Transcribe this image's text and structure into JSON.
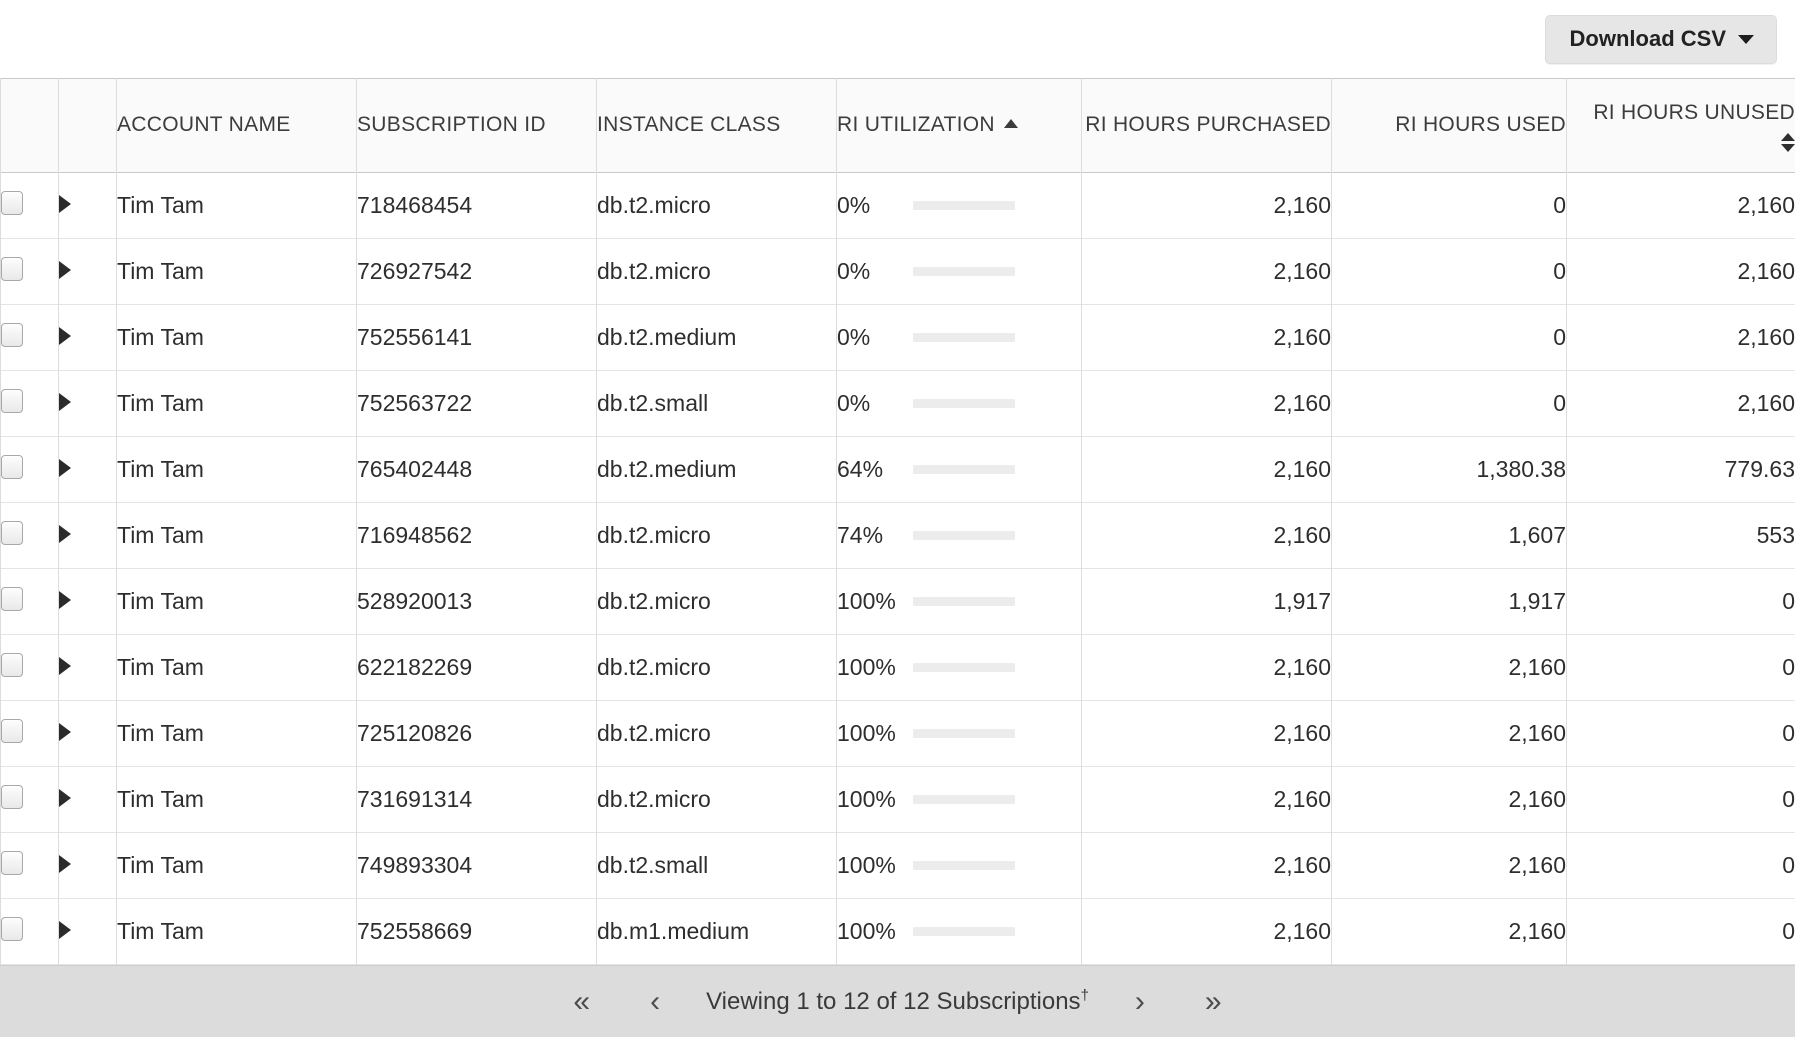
{
  "toolbar": {
    "download_label": "Download CSV",
    "caret_icon": "caret-down-icon"
  },
  "table": {
    "columns": [
      {
        "key": "check",
        "label": "",
        "align": "left",
        "sort": "none"
      },
      {
        "key": "expand",
        "label": "",
        "align": "left",
        "sort": "none"
      },
      {
        "key": "account",
        "label": "ACCOUNT NAME",
        "align": "left",
        "sort": "none"
      },
      {
        "key": "sub_id",
        "label": "SUBSCRIPTION ID",
        "align": "left",
        "sort": "none"
      },
      {
        "key": "instance",
        "label": "INSTANCE CLASS",
        "align": "left",
        "sort": "none"
      },
      {
        "key": "util",
        "label": "RI UTILIZATION",
        "align": "left",
        "sort": "asc"
      },
      {
        "key": "purchased",
        "label": "RI HOURS PURCHASED",
        "align": "right",
        "sort": "none"
      },
      {
        "key": "used",
        "label": "RI HOURS USED",
        "align": "right",
        "sort": "none"
      },
      {
        "key": "unused",
        "label": "RI HOURS UNUSED",
        "align": "right",
        "sort": "both"
      }
    ],
    "rows": [
      {
        "account": "Tim Tam",
        "sub_id": "718468454",
        "instance": "db.t2.micro",
        "util_text": "0%",
        "util_value": 0,
        "purchased": "2,160",
        "used": "0",
        "unused": "2,160"
      },
      {
        "account": "Tim Tam",
        "sub_id": "726927542",
        "instance": "db.t2.micro",
        "util_text": "0%",
        "util_value": 0,
        "purchased": "2,160",
        "used": "0",
        "unused": "2,160"
      },
      {
        "account": "Tim Tam",
        "sub_id": "752556141",
        "instance": "db.t2.medium",
        "util_text": "0%",
        "util_value": 0,
        "purchased": "2,160",
        "used": "0",
        "unused": "2,160"
      },
      {
        "account": "Tim Tam",
        "sub_id": "752563722",
        "instance": "db.t2.small",
        "util_text": "0%",
        "util_value": 0,
        "purchased": "2,160",
        "used": "0",
        "unused": "2,160"
      },
      {
        "account": "Tim Tam",
        "sub_id": "765402448",
        "instance": "db.t2.medium",
        "util_text": "64%",
        "util_value": 64,
        "purchased": "2,160",
        "used": "1,380.38",
        "unused": "779.63"
      },
      {
        "account": "Tim Tam",
        "sub_id": "716948562",
        "instance": "db.t2.micro",
        "util_text": "74%",
        "util_value": 74,
        "purchased": "2,160",
        "used": "1,607",
        "unused": "553"
      },
      {
        "account": "Tim Tam",
        "sub_id": "528920013",
        "instance": "db.t2.micro",
        "util_text": "100%",
        "util_value": 100,
        "purchased": "1,917",
        "used": "1,917",
        "unused": "0"
      },
      {
        "account": "Tim Tam",
        "sub_id": "622182269",
        "instance": "db.t2.micro",
        "util_text": "100%",
        "util_value": 100,
        "purchased": "2,160",
        "used": "2,160",
        "unused": "0"
      },
      {
        "account": "Tim Tam",
        "sub_id": "725120826",
        "instance": "db.t2.micro",
        "util_text": "100%",
        "util_value": 100,
        "purchased": "2,160",
        "used": "2,160",
        "unused": "0"
      },
      {
        "account": "Tim Tam",
        "sub_id": "731691314",
        "instance": "db.t2.micro",
        "util_text": "100%",
        "util_value": 100,
        "purchased": "2,160",
        "used": "2,160",
        "unused": "0"
      },
      {
        "account": "Tim Tam",
        "sub_id": "749893304",
        "instance": "db.t2.small",
        "util_text": "100%",
        "util_value": 100,
        "purchased": "2,160",
        "used": "2,160",
        "unused": "0"
      },
      {
        "account": "Tim Tam",
        "sub_id": "752558669",
        "instance": "db.m1.medium",
        "util_text": "100%",
        "util_value": 100,
        "purchased": "2,160",
        "used": "2,160",
        "unused": "0"
      }
    ]
  },
  "colors": {
    "bar_full": "#1f8a1f",
    "bar_partial": "#f0a22e",
    "bar_track": "#ececec",
    "footer_bg": "#dcdcdc",
    "header_bg": "#fafafa"
  },
  "footer": {
    "first_icon": "«",
    "prev_icon": "‹",
    "viewing_text": "Viewing 1 to 12 of 12 Subscriptions",
    "viewing_dagger": "†",
    "next_icon": "›",
    "last_icon": "»"
  }
}
